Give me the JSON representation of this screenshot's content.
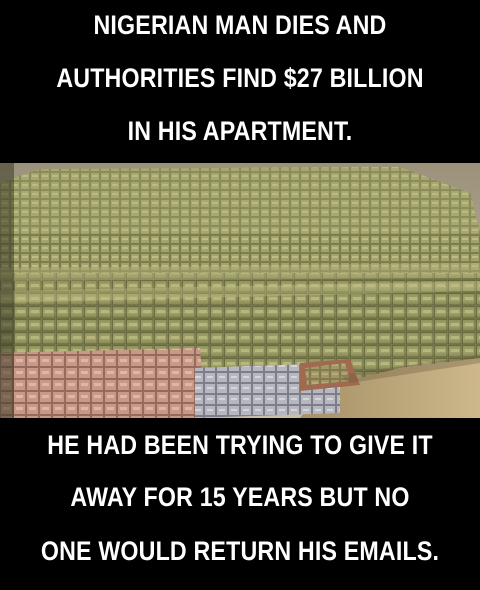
{
  "top_caption": {
    "line1": "NIGERIAN MAN DIES AND",
    "line2": "AUTHORITIES FIND $27 BILLION",
    "line3": "IN HIS APARTMENT."
  },
  "bottom_caption": {
    "line1": "HE HAD BEEN TRYING TO GIVE IT",
    "line2": "AWAY FOR 15 YEARS BUT NO",
    "line3": "ONE WOULD RETURN HIS EMAILS."
  },
  "colors": {
    "background": "#000000",
    "text": "#ffffff",
    "cash_green": "#9a9a62",
    "cash_pink": "#c89a8a",
    "wall": "#bfb49a",
    "floor": "#b8a37a"
  }
}
